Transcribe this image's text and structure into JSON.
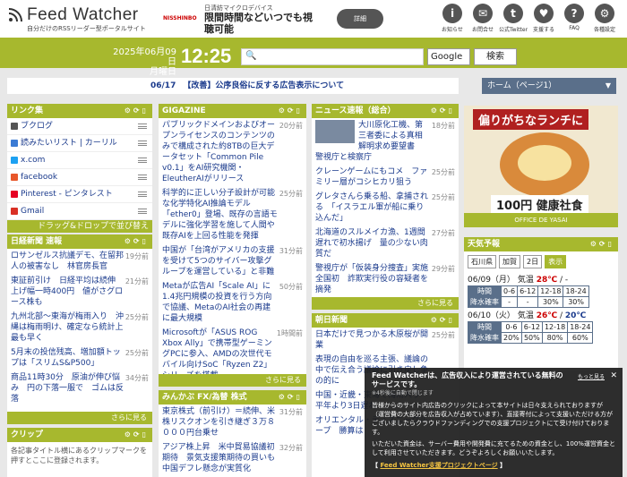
{
  "header": {
    "logo": "Feed Watcher",
    "sub": "自分だけのRSSリーダー型ポータルサイト",
    "ad": {
      "brand": "NISSHINBO",
      "top": "日清紡マイクロデバイス",
      "main": "限間時間などいつでも視聴可能",
      "btn": "詳細"
    },
    "icons": [
      {
        "name": "info-icon",
        "g": "i",
        "label": "お知らせ"
      },
      {
        "name": "mail-icon",
        "g": "✉",
        "label": "お問合せ"
      },
      {
        "name": "twitter-icon",
        "g": "t",
        "label": "公式Twitter"
      },
      {
        "name": "gift-icon",
        "g": "♥",
        "label": "支援する"
      },
      {
        "name": "faq-icon",
        "g": "?",
        "label": "FAQ"
      },
      {
        "name": "gear-icon",
        "g": "⚙",
        "label": "各種設定"
      }
    ]
  },
  "topbar": {
    "date": "2025年06月09日",
    "weekday": "月曜日",
    "time": "12:25",
    "engine": "Google",
    "search": "検索"
  },
  "notice": {
    "date": "06/17",
    "text": "【改善】公序良俗に反する広告表示について"
  },
  "home": "ホーム（ページ1）",
  "links": {
    "title": "リンク集",
    "items": [
      "ブクログ",
      "読みたいリスト | カーリル",
      "x.com",
      "facebook",
      "Pinterest - ピンタレスト",
      "Gmail"
    ],
    "drag": "ドラッグ&ドロップで並び替え"
  },
  "nikkei": {
    "title": "日経新聞 速報",
    "items": [
      {
        "t": "ロサンゼルス抗議デモ、在留邦人の被害なし　林官房長官",
        "m": "19分前"
      },
      {
        "t": "東証前引け　日経平均は続伸　上げ幅一時400円　値がさグロース株も",
        "m": "21分前"
      },
      {
        "t": "九州北部〜東海が梅雨入り　沖縄は梅雨明け、確定なら統計上最も早く",
        "m": "25分前"
      },
      {
        "t": "5月末の投信残高、増加額トップは「スリムS&P500」",
        "m": "25分前"
      },
      {
        "t": "商品11時30分　原油が伸び悩み　円の下落一服で　ゴムは反落",
        "m": "34分前"
      }
    ],
    "more": "さらに見る"
  },
  "clip": {
    "title": "クリップ",
    "text": "各記事タイトル横にあるクリップマークを押すとここに登録されます。"
  },
  "gigazine": {
    "title": "GIGAZINE",
    "items": [
      {
        "t": "パブリックドメインおよびオープンライセンスのコンテンツのみで構成された約8TBの巨大データセット「Common Pile v0.1」をAI研究機関・EleutherAIがリリース",
        "m": "20分前"
      },
      {
        "t": "科学的に正しい分子設計が可能な化学特化AI推論モデル「ether0」登場、既存の言語モデルに強化学習を施して人間や既存AIを上回る性能を発揮",
        "m": "25分前"
      },
      {
        "t": "中国が「台湾がアメリカの支援を受けて5つのサイバー攻撃グループを運営している」と非難",
        "m": "31分前"
      },
      {
        "t": "Metaが広告AI「Scale AI」に1.4兆円規模の投資を行う方向で協議、MetaのAI社会の再建に最大規模",
        "m": "50分前"
      },
      {
        "t": "Microsoftが「ASUS ROG Xbox Ally」で携帯型ゲーミングPCに参入、AMDの次世代モバイル向けSoC「Ryzen Z2」シリーズを搭載",
        "m": "1時間前"
      }
    ],
    "more": "さらに見る"
  },
  "minkabu": {
    "title": "みんかぶ FX/為替 株式",
    "items": [
      {
        "t": "東京株式（前引け）＝続伸、米株リスクオンを引き継ぎ３万８０００円台乗せ",
        "m": "31分前"
      },
      {
        "t": "アジア株上昇　米中貿易協議初期待　景気支援策期待の買いも　中国デフレ懸念が実質化",
        "m": "32分前"
      }
    ]
  },
  "news": {
    "title": "ニュース速報（総合）",
    "items": [
      {
        "t": "大川原化工機、第三者委による真相解明求め要望書　警視庁と検察庁",
        "m": "18分前"
      },
      {
        "t": "クレーンゲームにもコメ　ファミリー層がコシヒカリ狙う",
        "m": "25分前"
      },
      {
        "t": "グレタさんら乗る船、拿捕される　「イスラエル軍が船に乗り込んだ」",
        "m": "25分前"
      },
      {
        "t": "北海道のスルメイカ漁、1週間遅れで初水揚げ　量の少ない肉質だ",
        "m": "27分前"
      },
      {
        "t": "警視庁が「仮装身分捜査」実施　全国初　詐欺実行役の容疑者を摘発",
        "m": "29分前"
      }
    ],
    "more": "さらに見る"
  },
  "asahi": {
    "title": "朝日新聞",
    "items": [
      {
        "t": "日本だけで見つかる木原桜が開業",
        "m": "25分前"
      },
      {
        "t": "表現の自由を巡る主張、議論の中で伝え合う議論に引き戻し争の的に",
        "m": ""
      },
      {
        "t": "中国・近畿・東海で梅雨入り　平年より3日遅れ",
        "m": ""
      },
      {
        "t": "オリエンタル・ディズニーグループ　勝算は",
        "m": ""
      }
    ]
  },
  "ad2": {
    "top": "偏りがちなランチに",
    "price": "100円 健康社食",
    "brand": "OFFICE DE YASAI"
  },
  "weather": {
    "title": "天気予報",
    "pref": "石川県",
    "city": "加賀",
    "days": "2日",
    "show": "表示",
    "d1": {
      "date": "06/09（月）",
      "kind": "気温",
      "hi": "28℃",
      "lo": "-"
    },
    "d2": {
      "date": "06/10（火）",
      "kind": "気温",
      "hi": "26℃",
      "lo": "20℃"
    },
    "hours": [
      "時間",
      "0-6",
      "6-12",
      "12-18",
      "18-24"
    ],
    "r1": [
      "降水確率",
      "-",
      "-",
      "30%",
      "30%"
    ],
    "r2": [
      "降水確率",
      "20%",
      "50%",
      "80%",
      "60%"
    ]
  },
  "popup": {
    "title": "Feed Watcherは、広告収入により運営されている無料のサービスです。",
    "sub": "※4秒後に自動で閉じます",
    "more": "もっと見る",
    "body": "皆様からのサイト内広告のクリックによって本サイトは日々支えられておりますが（運営費の大部分を広告収入が占めています）、直接寄付によって支援いただける方がございましたらクラウドファンディングでの支援プロジェクトにて受け付けております。",
    "body2": "いただいた資金は、サーバー費用や開発費に充てるための資金とし、100%運営資金として利用させていただきます。どうぞよろしくお願いいたします。",
    "link": "Feed Watcher支援プロジェクトページ"
  }
}
